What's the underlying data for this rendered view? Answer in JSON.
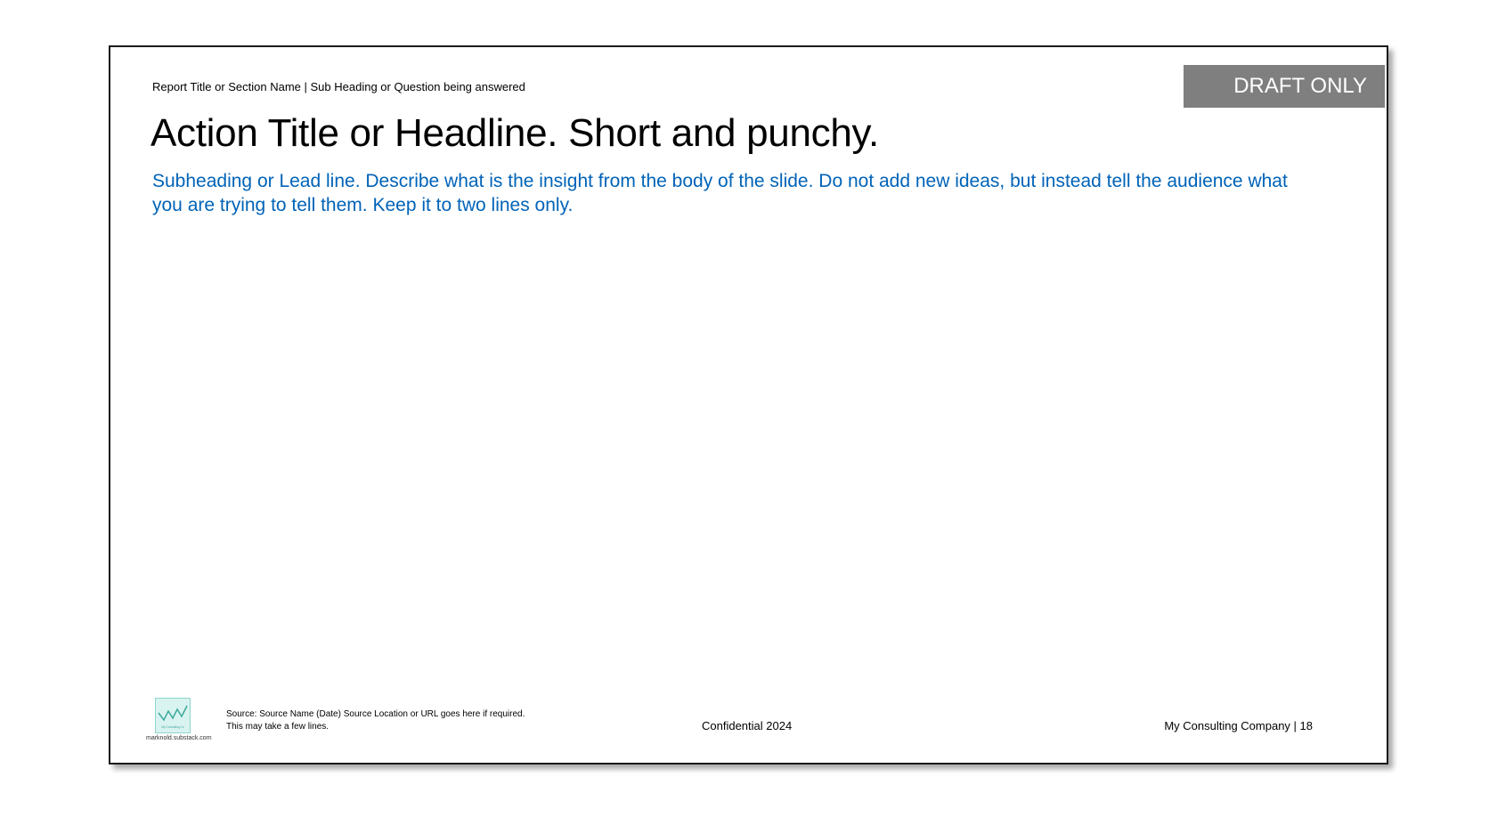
{
  "header": {
    "breadcrumb": "Report Title or Section Name | Sub Heading or Question being answered",
    "draft_badge": "DRAFT ONLY"
  },
  "title": {
    "action_title": "Action Title or Headline. Short and punchy.",
    "lead_line": "Subheading or Lead line. Describe what is the insight from the body of the slide. Do not add new ideas, but instead tell the audience what you are trying to tell them. Keep it to two lines only."
  },
  "footer": {
    "logo_text": "My Consulting Co",
    "logo_caption": "marknold.substack.com",
    "source_line_1": "Source: Source Name (Date) Source Location or URL goes here if required.",
    "source_line_2": "This may take a few lines.",
    "confidential": "Confidential 2024",
    "company_page": "My Consulting Company  | 18"
  },
  "colors": {
    "lead_line": "#0063b8",
    "draft_badge_bg": "#7f7f7f",
    "logo_bg": "#d9f3f0"
  }
}
